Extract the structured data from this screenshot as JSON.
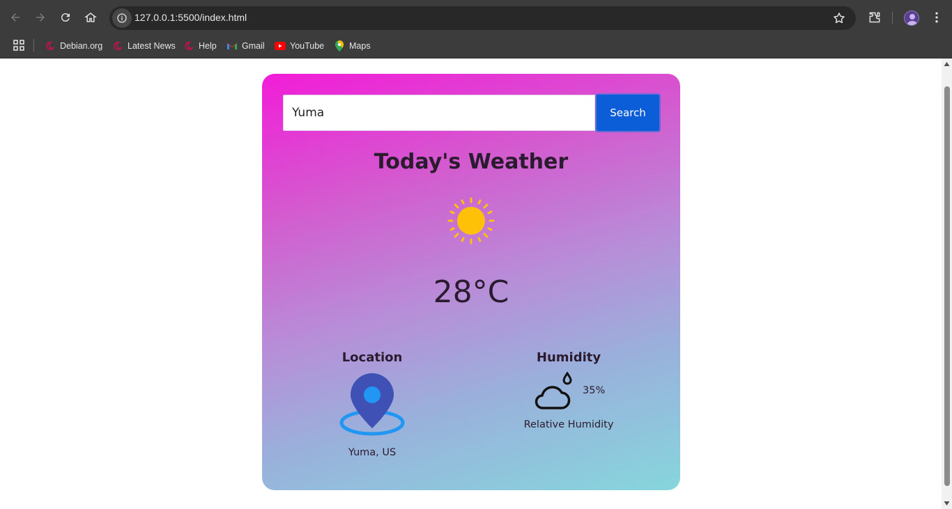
{
  "browser": {
    "url": "127.0.0.1:5500/index.html",
    "bookmarks": [
      {
        "label": "Debian.org",
        "icon": "debian-icon"
      },
      {
        "label": "Latest News",
        "icon": "debian-icon"
      },
      {
        "label": "Help",
        "icon": "debian-icon"
      },
      {
        "label": "Gmail",
        "icon": "gmail-icon"
      },
      {
        "label": "YouTube",
        "icon": "youtube-icon"
      },
      {
        "label": "Maps",
        "icon": "maps-icon"
      }
    ]
  },
  "app": {
    "search": {
      "value": "Yuma",
      "button_label": "Search"
    },
    "title": "Today's Weather",
    "weather_icon": "sun-icon",
    "temperature": "28°C",
    "location": {
      "title": "Location",
      "icon": "location-pin-icon",
      "value": "Yuma, US"
    },
    "humidity": {
      "title": "Humidity",
      "icon": "cloud-humidity-icon",
      "value": "35%",
      "label": "Relative Humidity"
    }
  },
  "colors": {
    "card_top": "#f21cd8",
    "card_bottom": "#86d6dc",
    "search_button": "#0b5ed7",
    "sun": "#ffc107",
    "pin_dark": "#3f51b5",
    "pin_light": "#2196f3"
  }
}
